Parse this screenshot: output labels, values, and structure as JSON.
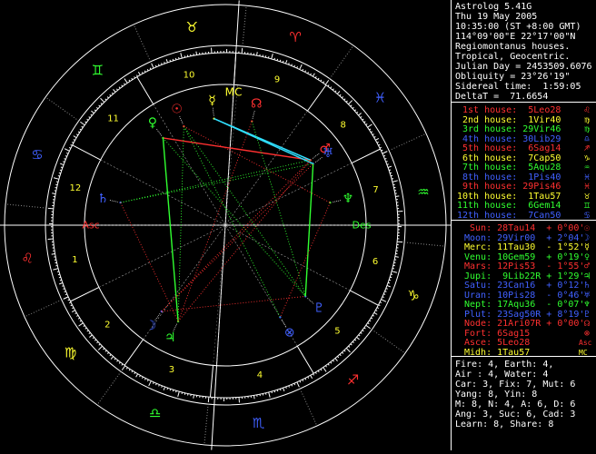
{
  "app": {
    "name": "Astrolog 5.41G"
  },
  "chart_info": [
    "Thu 19 May 2005",
    "10:35:00 (ST +8:00 GMT)",
    "114°09'00\"E 22°17'00\"N",
    "Regiomontanus houses.",
    "Tropical, Geocentric.",
    "Julian Day = 2453509.6076",
    "Obliquity = 23°26'19\"",
    "Sidereal time:  1:59:05",
    "DeltaT =  71.6654"
  ],
  "houses": [
    {
      "label": "1st house:",
      "pos": "5Leo28",
      "color": "#ff3030",
      "glyph": "♌"
    },
    {
      "label": "2nd house:",
      "pos": "1Vir40",
      "color": "#ffff30",
      "glyph": "♍"
    },
    {
      "label": "3rd house:",
      "pos": "29Vir46",
      "color": "#30ff30",
      "glyph": "♍"
    },
    {
      "label": "4th house:",
      "pos": "30Lib29",
      "color": "#4060ff",
      "glyph": "♎"
    },
    {
      "label": "5th house:",
      "pos": "6Sag14",
      "color": "#ff3030",
      "glyph": "♐"
    },
    {
      "label": "6th house:",
      "pos": "7Cap50",
      "color": "#ffff30",
      "glyph": "♑"
    },
    {
      "label": "7th house:",
      "pos": "5Aqu28",
      "color": "#30ff30",
      "glyph": "♒"
    },
    {
      "label": "8th house:",
      "pos": "1Pis40",
      "color": "#4060ff",
      "glyph": "♓"
    },
    {
      "label": "9th house:",
      "pos": "29Pis46",
      "color": "#ff3030",
      "glyph": "♓"
    },
    {
      "label": "10th house:",
      "pos": "1Tau57",
      "color": "#ffff30",
      "glyph": "♉"
    },
    {
      "label": "11th house:",
      "pos": "6Gem14",
      "color": "#30ff30",
      "glyph": "♊"
    },
    {
      "label": "12th house:",
      "pos": "7Can50",
      "color": "#4060ff",
      "glyph": "♋"
    }
  ],
  "planets": [
    {
      "name": "Sun:",
      "pos": "28Tau14",
      "rate": "+ 0°00'",
      "color": "#ff3030",
      "glyph": "☉"
    },
    {
      "name": "Moon:",
      "pos": "29Vir00",
      "rate": "+ 2°04'",
      "color": "#4060ff",
      "glyph": "☽"
    },
    {
      "name": "Merc:",
      "pos": "11Tau30",
      "rate": "- 1°52'",
      "color": "#ffff30",
      "glyph": "☿"
    },
    {
      "name": "Venu:",
      "pos": "10Gem59",
      "rate": "+ 0°19'",
      "color": "#30ff30",
      "glyph": "♀"
    },
    {
      "name": "Mars:",
      "pos": "12Pis53",
      "rate": "- 1°55'",
      "color": "#ff3030",
      "glyph": "♂"
    },
    {
      "name": "Jupi:",
      "pos": " 9Lib22R",
      "rate": "+ 1°29'",
      "color": "#30ff30",
      "glyph": "♃"
    },
    {
      "name": "Satu:",
      "pos": "23Can16",
      "rate": "+ 0°12'",
      "color": "#4060ff",
      "glyph": "♄"
    },
    {
      "name": "Uran:",
      "pos": "10Pis28",
      "rate": "- 0°46'",
      "color": "#4060ff",
      "glyph": "♅"
    },
    {
      "name": "Nept:",
      "pos": "17Aqu36",
      "rate": "- 0°07'",
      "color": "#30ff30",
      "glyph": "♆"
    },
    {
      "name": "Plut:",
      "pos": "23Sag50R",
      "rate": "+ 8°19'",
      "color": "#4060ff",
      "glyph": "♇"
    },
    {
      "name": "Node:",
      "pos": "21Ari07R",
      "rate": "+ 0°00'",
      "color": "#ff3030",
      "glyph": "☊"
    },
    {
      "name": "Fort:",
      "pos": "6Sag15",
      "rate": "",
      "color": "#ff3030",
      "glyph": "⊗"
    },
    {
      "name": "Asce:",
      "pos": "5Leo28",
      "rate": "",
      "color": "#ff3030",
      "glyph": "Asc"
    },
    {
      "name": "Midh:",
      "pos": "1Tau57",
      "rate": "",
      "color": "#ffff30",
      "glyph": "MC"
    }
  ],
  "stats": [
    "Fire: 4, Earth: 4,",
    "Air : 4, Water: 4",
    "Car: 3, Fix: 7, Mut: 6",
    "Yang: 8, Yin: 8",
    "M: 8, N: 4, A: 6, D: 6",
    "Ang: 3, Suc: 6, Cad: 3",
    "Learn: 8, Share: 8"
  ],
  "chart_data": {
    "type": "astrological wheel",
    "ascendant_deg": 125.47,
    "signs": [
      {
        "sign": "Aries",
        "glyph": "♈",
        "color": "#ff3030"
      },
      {
        "sign": "Taurus",
        "glyph": "♉",
        "color": "#ffff30"
      },
      {
        "sign": "Gemini",
        "glyph": "♊",
        "color": "#30ff30"
      },
      {
        "sign": "Cancer",
        "glyph": "♋",
        "color": "#4060ff"
      },
      {
        "sign": "Leo",
        "glyph": "♌",
        "color": "#ff3030"
      },
      {
        "sign": "Virgo",
        "glyph": "♍",
        "color": "#ffff30"
      },
      {
        "sign": "Libra",
        "glyph": "♎",
        "color": "#30ff30"
      },
      {
        "sign": "Scorpio",
        "glyph": "♏",
        "color": "#4060ff"
      },
      {
        "sign": "Sagittarius",
        "glyph": "♐",
        "color": "#ff3030"
      },
      {
        "sign": "Capricorn",
        "glyph": "♑",
        "color": "#ffff30"
      },
      {
        "sign": "Aquarius",
        "glyph": "♒",
        "color": "#30ff30"
      },
      {
        "sign": "Pisces",
        "glyph": "♓",
        "color": "#4060ff"
      }
    ],
    "house_cusps_deg": [
      125.47,
      151.67,
      179.77,
      210.48,
      246.23,
      277.83,
      305.47,
      331.67,
      359.77,
      31.95,
      66.23,
      97.83
    ],
    "house_numbers": [
      "1",
      "2",
      "3",
      "4",
      "5",
      "6",
      "7",
      "8",
      "9",
      "10",
      "11",
      "12"
    ],
    "axis_labels": {
      "asc": "Asc",
      "dsc": "Des",
      "mc": "MC"
    },
    "planets": [
      {
        "name": "Sun",
        "glyph": "☉",
        "lon": 58.23,
        "color": "#ff3030"
      },
      {
        "name": "Moon",
        "glyph": "☽",
        "lon": 179.0,
        "color": "#4060ff"
      },
      {
        "name": "Mercury",
        "glyph": "☿",
        "lon": 41.5,
        "color": "#ffff30"
      },
      {
        "name": "Venus",
        "glyph": "♀",
        "lon": 70.98,
        "color": "#30ff30"
      },
      {
        "name": "Mars",
        "glyph": "♂",
        "lon": 342.88,
        "color": "#ff3030"
      },
      {
        "name": "Jupiter",
        "glyph": "♃",
        "lon": 189.37,
        "color": "#30ff30"
      },
      {
        "name": "Saturn",
        "glyph": "♄",
        "lon": 113.27,
        "color": "#4060ff"
      },
      {
        "name": "Uranus",
        "glyph": "♅",
        "lon": 340.47,
        "color": "#4060ff"
      },
      {
        "name": "Neptune",
        "glyph": "♆",
        "lon": 317.6,
        "color": "#30ff30"
      },
      {
        "name": "Pluto",
        "glyph": "♇",
        "lon": 263.83,
        "color": "#4060ff"
      },
      {
        "name": "Node",
        "glyph": "☊",
        "lon": 21.12,
        "color": "#ff3030"
      },
      {
        "name": "Fortune",
        "glyph": "⊗",
        "lon": 246.25,
        "color": "#4060ff"
      }
    ],
    "aspects": [
      {
        "a": "Mars",
        "b": "Venus",
        "color": "#ff3030",
        "style": "solid"
      },
      {
        "a": "Uranus",
        "b": "Mercury",
        "color": "#30e0ff",
        "style": "solid"
      },
      {
        "a": "Mars",
        "b": "Mercury",
        "color": "#30e0ff",
        "style": "solid"
      },
      {
        "a": "Venus",
        "b": "Jupiter",
        "color": "#30ff30",
        "style": "solid"
      },
      {
        "a": "Uranus",
        "b": "Pluto",
        "color": "#30ff30",
        "style": "solid"
      },
      {
        "a": "Sun",
        "b": "Jupiter",
        "color": "#30ff30",
        "style": "dotted"
      },
      {
        "a": "Sun",
        "b": "Pluto",
        "color": "#30ff30",
        "style": "dotted"
      },
      {
        "a": "Venus",
        "b": "Pluto",
        "color": "#30ff30",
        "style": "dotted"
      },
      {
        "a": "Saturn",
        "b": "Mars",
        "color": "#30ff30",
        "style": "dotted"
      },
      {
        "a": "Saturn",
        "b": "Uranus",
        "color": "#30ff30",
        "style": "dotted"
      },
      {
        "a": "Sun",
        "b": "Fortune",
        "color": "#30ff30",
        "style": "dotted"
      },
      {
        "a": "Moon",
        "b": "Mars",
        "color": "#ff3030",
        "style": "dotted"
      },
      {
        "a": "Moon",
        "b": "Uranus",
        "color": "#ff3030",
        "style": "dotted"
      },
      {
        "a": "Jupiter",
        "b": "Mars",
        "color": "#ff3030",
        "style": "dotted"
      },
      {
        "a": "Saturn",
        "b": "Jupiter",
        "color": "#ff3030",
        "style": "dotted"
      },
      {
        "a": "Node",
        "b": "Jupiter",
        "color": "#ff3030",
        "style": "dotted"
      },
      {
        "a": "Neptune",
        "b": "Fortune",
        "color": "#ff3030",
        "style": "dotted"
      },
      {
        "a": "Sun",
        "b": "Neptune",
        "color": "#ff3030",
        "style": "dotted"
      },
      {
        "a": "Node",
        "b": "Pluto",
        "color": "#30ff30",
        "style": "dotted"
      },
      {
        "a": "Moon",
        "b": "Pluto",
        "color": "#ff3030",
        "style": "dotted"
      }
    ]
  }
}
